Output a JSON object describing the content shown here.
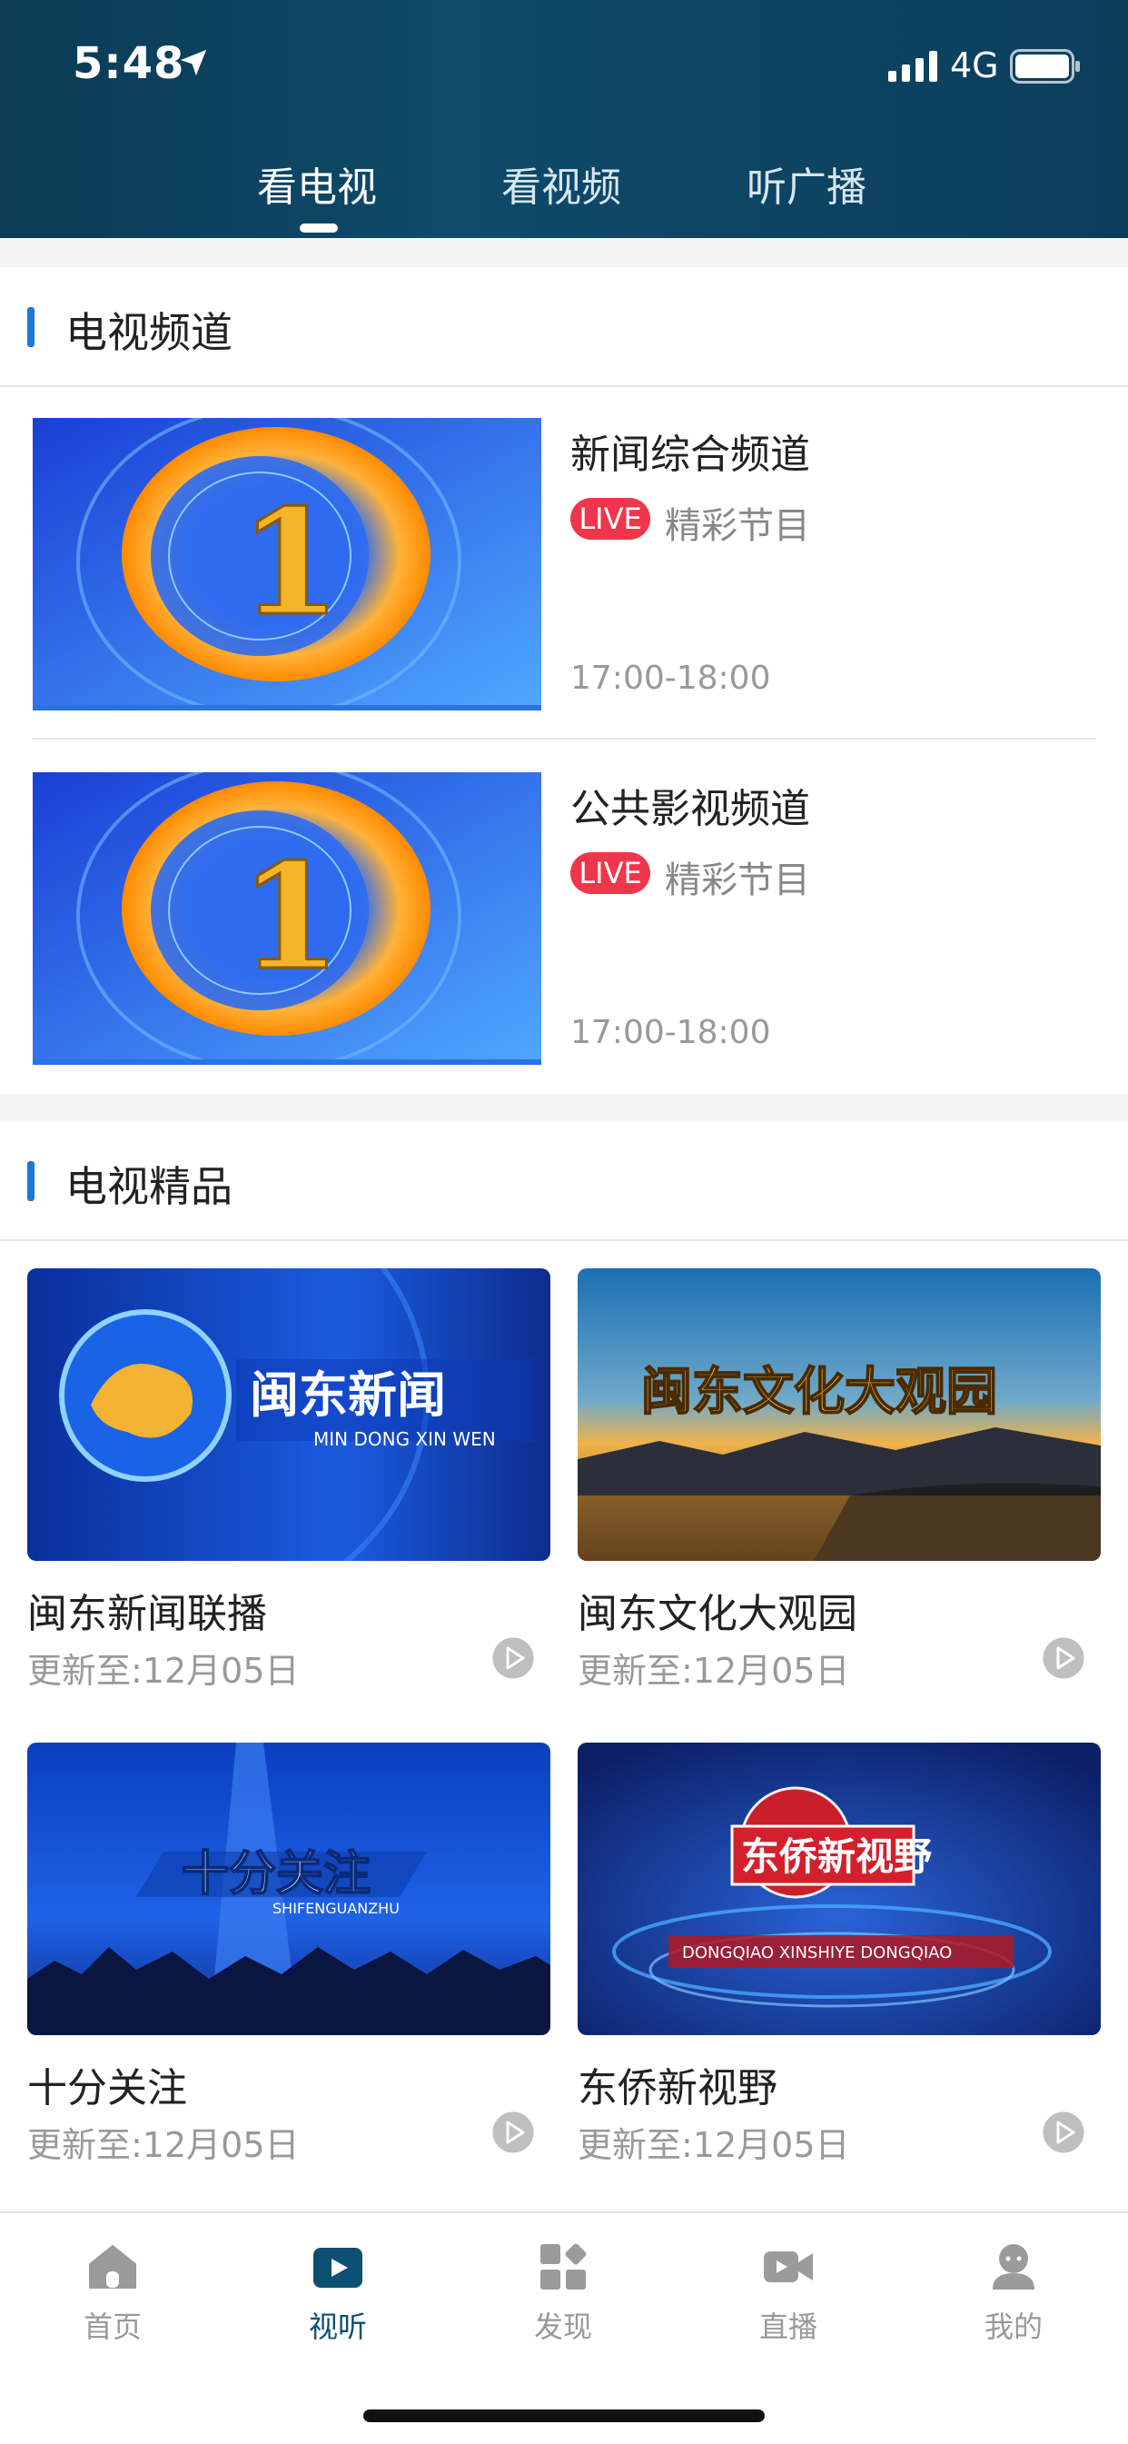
{
  "status": {
    "time": "5:48",
    "network": "4G"
  },
  "top_tabs": [
    {
      "label": "看电视",
      "active": true
    },
    {
      "label": "看视频",
      "active": false
    },
    {
      "label": "听广播",
      "active": false
    }
  ],
  "tv_channels": {
    "title": "电视频道",
    "items": [
      {
        "name": "新闻综合频道",
        "live": "LIVE",
        "program": "精彩节目",
        "time": "17:00-18:00",
        "thumb_text": "1"
      },
      {
        "name": "公共影视频道",
        "live": "LIVE",
        "program": "精彩节目",
        "time": "17:00-18:00",
        "thumb_text": "1"
      }
    ]
  },
  "tv_premium": {
    "title": "电视精品",
    "items": [
      {
        "title": "闽东新闻联播",
        "updated": "更新至:12月05日",
        "logo_text": "闽东新闻",
        "logo_sub": "MIN DONG XIN WEN"
      },
      {
        "title": "闽东文化大观园",
        "updated": "更新至:12月05日",
        "logo_text": "闽东文化大观园",
        "logo_sub": ""
      },
      {
        "title": "十分关注",
        "updated": "更新至:12月05日",
        "logo_text": "十分关注",
        "logo_sub": "SHIFENGUANZHU"
      },
      {
        "title": "东侨新视野",
        "updated": "更新至:12月05日",
        "logo_text": "东侨新视野",
        "logo_sub": "DONGQIAO XINSHIYE DONGQIAO"
      }
    ]
  },
  "tab_bar": [
    {
      "label": "首页",
      "icon": "home-icon",
      "active": false
    },
    {
      "label": "视听",
      "icon": "play-icon",
      "active": true
    },
    {
      "label": "发现",
      "icon": "discover-icon",
      "active": false
    },
    {
      "label": "直播",
      "icon": "video-camera-icon",
      "active": false
    },
    {
      "label": "我的",
      "icon": "profile-icon",
      "active": false
    }
  ],
  "colors": {
    "header": "#0d4564",
    "accent": "#1f78d8",
    "live": "#f0364b",
    "tab_active": "#0e5072"
  }
}
